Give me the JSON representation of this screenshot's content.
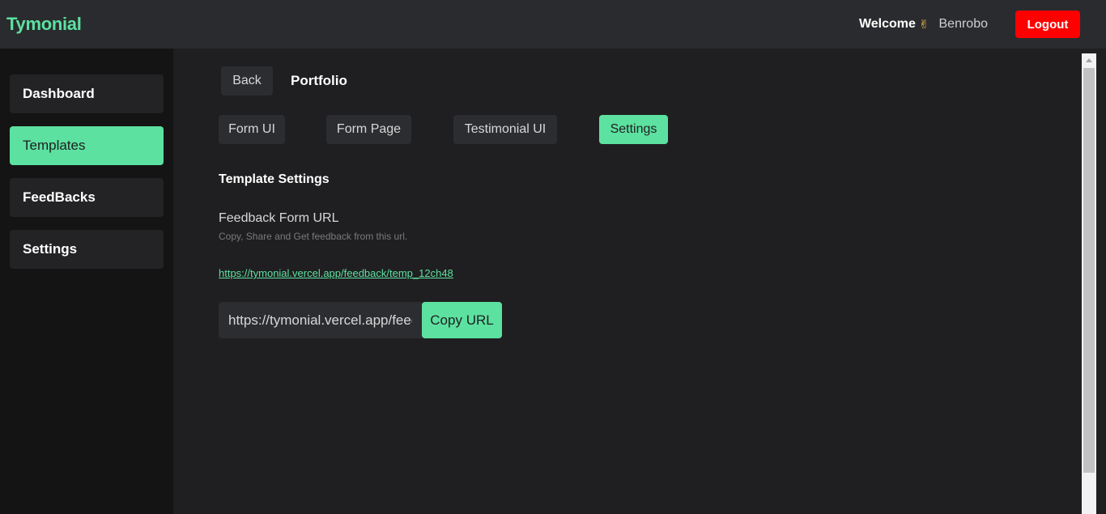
{
  "header": {
    "brand": "Tymonial",
    "welcome": "Welcome",
    "wave_emoji": "✌",
    "username": "Benrobo",
    "logout_label": "Logout"
  },
  "sidebar": {
    "items": [
      {
        "label": "Dashboard",
        "active": false
      },
      {
        "label": "Templates",
        "active": true
      },
      {
        "label": "FeedBacks",
        "active": false
      },
      {
        "label": "Settings",
        "active": false
      }
    ]
  },
  "main": {
    "back_label": "Back",
    "breadcrumb": "Portfolio",
    "tabs": [
      {
        "label": "Form UI",
        "active": false
      },
      {
        "label": "Form Page",
        "active": false
      },
      {
        "label": "Testimonial UI",
        "active": false
      },
      {
        "label": "Settings",
        "active": true
      }
    ],
    "section_title": "Template Settings",
    "field_label": "Feedback Form URL",
    "field_help": "Copy, Share and Get feedback from this url.",
    "url": "https://tymonial.vercel.app/feedback/temp_12ch48",
    "copy_label": "Copy URL"
  },
  "colors": {
    "accent": "#5ce1a0",
    "danger": "#ff0000",
    "background": "#1f1f21",
    "sidebar": "#141414",
    "topbar": "#2a2b2e"
  }
}
